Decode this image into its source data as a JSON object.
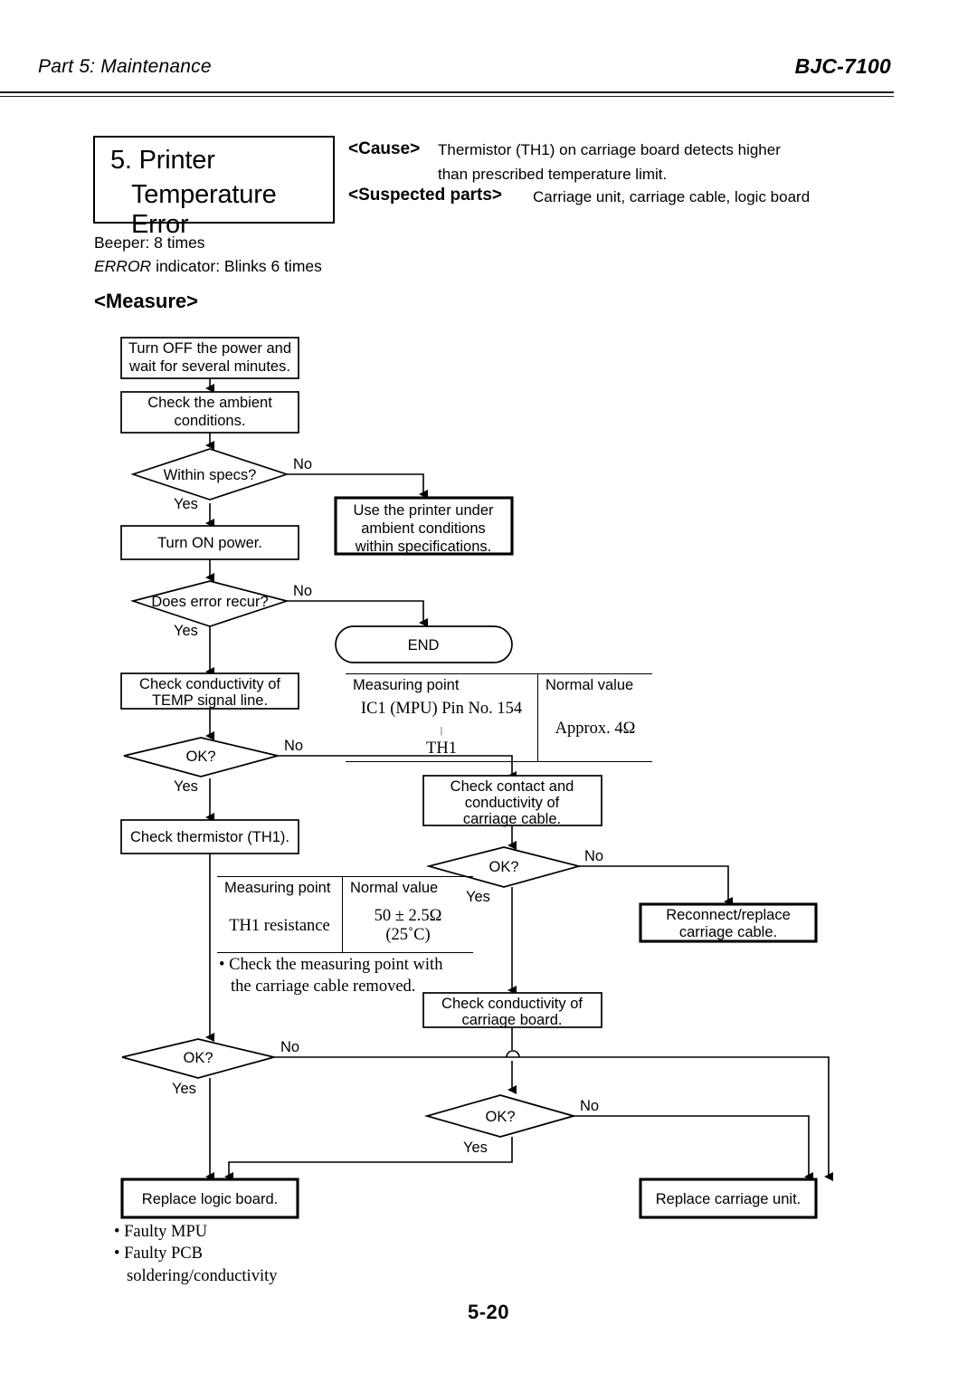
{
  "header": {
    "left": "Part 5: Maintenance",
    "right": "BJC-7100"
  },
  "title_box": {
    "line1": "5. Printer",
    "line2": "Temperature Error"
  },
  "indicators": {
    "beeper": "Beeper: 8 times",
    "error_prefix": "ERROR",
    "error_rest": " indicator: Blinks 6 times"
  },
  "cause": {
    "label": "<Cause>",
    "line1": "Thermistor (TH1) on carriage board detects higher",
    "line2": "than prescribed temperature limit."
  },
  "suspected": {
    "label": "<Suspected parts>",
    "text": "Carriage unit, carriage cable, logic board"
  },
  "measure_heading": "<Measure>",
  "flow": {
    "n1_l1": "Turn OFF the power and",
    "n1_l2": "wait for several minutes.",
    "n2_l1": "Check the ambient",
    "n2_l2": "conditions.",
    "d1": "Within specs?",
    "d1_no": "No",
    "d1_yes": "Yes",
    "n3": "Turn ON power.",
    "n4_l1": "Use the printer under",
    "n4_l2": "ambient conditions",
    "n4_l3": "within specifications.",
    "d2": "Does error recur?",
    "d2_no": "No",
    "d2_yes": "Yes",
    "end": "END",
    "n5_l1": "Check conductivity of",
    "n5_l2": "TEMP signal line.",
    "d3": "OK?",
    "d3_no": "No",
    "d3_yes": "Yes",
    "n6_l1": "Check contact and",
    "n6_l2": "conductivity of",
    "n6_l3": "carriage cable.",
    "n7": "Check thermistor (TH1).",
    "d4": "OK?",
    "d4_no": "No",
    "d4_yes": "Yes",
    "n8_l1": "Reconnect/replace",
    "n8_l2": "carriage cable.",
    "n9_l1": "Check conductivity of",
    "n9_l2": "carriage board.",
    "d5": "OK?",
    "d5_no": "No",
    "d5_yes": "Yes",
    "d6": "OK?",
    "d6_no": "No",
    "d6_yes": "Yes",
    "n10": "Replace logic board.",
    "n11": "Replace carriage unit."
  },
  "table1": {
    "headers": [
      "Measuring point",
      "Normal value"
    ],
    "row_point_l1": "IC1 (MPU) Pin No. 154",
    "row_point_sep": "|",
    "row_point_l2": "TH1",
    "row_value": "Approx. 4Ω"
  },
  "table2": {
    "headers": [
      "Measuring point",
      "Normal value"
    ],
    "row_point": "TH1 resistance",
    "row_value": "50 ± 2.5Ω (25˚C)",
    "note_l1": "• Check the measuring point with",
    "note_l2": "the carriage cable removed."
  },
  "footnotes": {
    "l1": "• Faulty MPU",
    "l2": "• Faulty PCB",
    "l3": "soldering/conductivity"
  },
  "page_number": "5-20"
}
